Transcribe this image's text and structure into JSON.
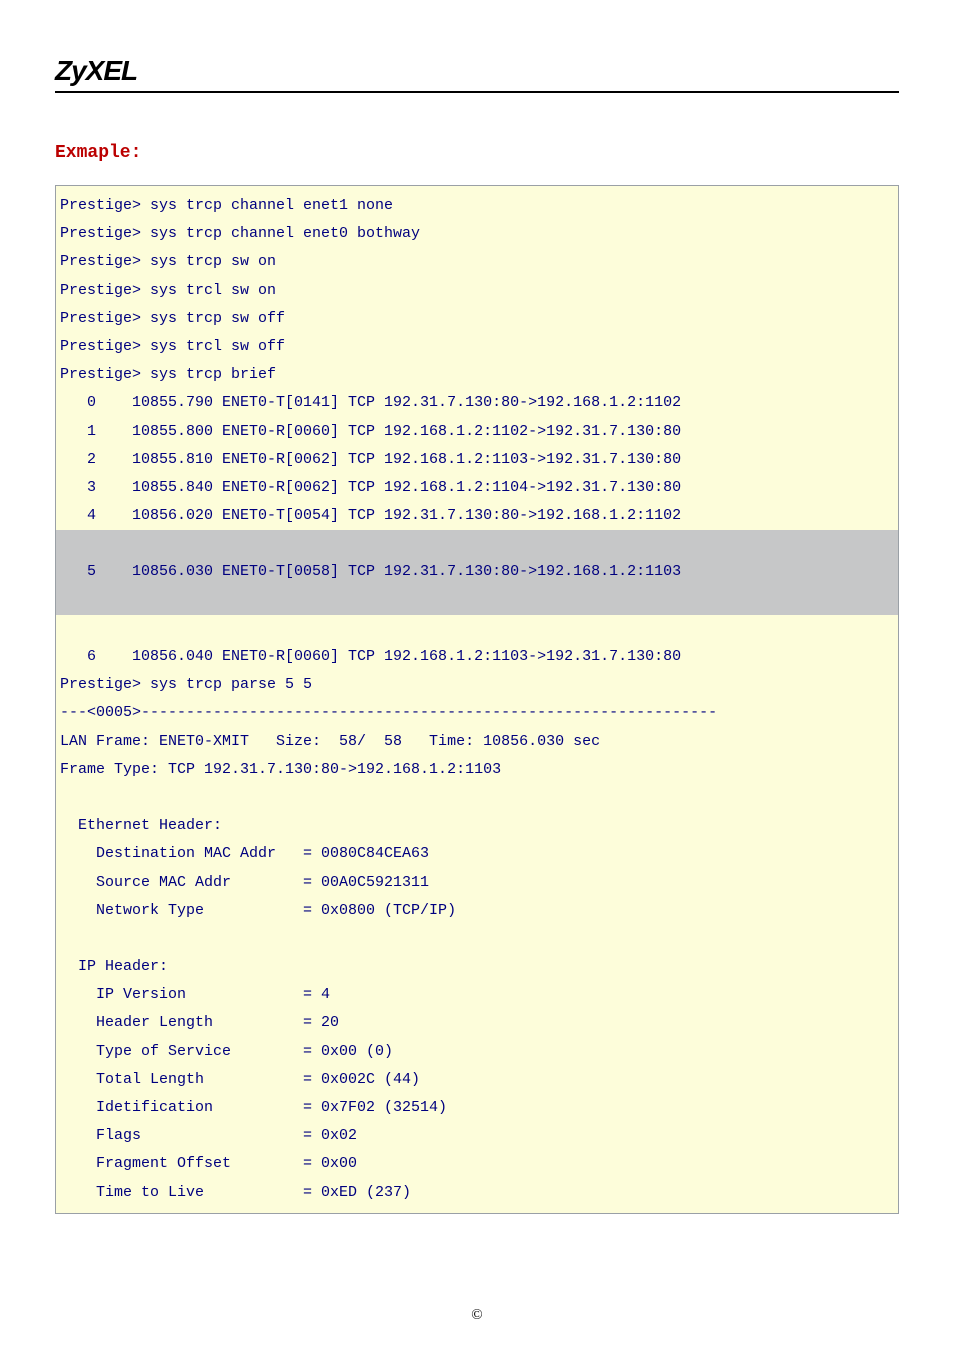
{
  "brand": "ZyXEL",
  "heading": "Exmaple:",
  "code": {
    "lines": [
      "Prestige> sys trcp channel enet1 none",
      "Prestige> sys trcp channel enet0 bothway",
      "Prestige> sys trcp sw on",
      "Prestige> sys trcl sw on",
      "Prestige> sys trcp sw off",
      "Prestige> sys trcl sw off",
      "Prestige> sys trcp brief",
      "   0    10855.790 ENET0-T[0141] TCP 192.31.7.130:80->192.168.1.2:1102",
      "   1    10855.800 ENET0-R[0060] TCP 192.168.1.2:1102->192.31.7.130:80",
      "   2    10855.810 ENET0-R[0062] TCP 192.168.1.2:1103->192.31.7.130:80",
      "   3    10855.840 ENET0-R[0062] TCP 192.168.1.2:1104->192.31.7.130:80",
      "   4    10856.020 ENET0-T[0054] TCP 192.31.7.130:80->192.168.1.2:1102",
      "",
      "   5    10856.030 ENET0-T[0058] TCP 192.31.7.130:80->192.168.1.2:1103",
      "",
      "",
      "   6    10856.040 ENET0-R[0060] TCP 192.168.1.2:1103->192.31.7.130:80",
      "Prestige> sys trcp parse 5 5",
      "---<0005>----------------------------------------------------------------",
      "LAN Frame: ENET0-XMIT   Size:  58/  58   Time: 10856.030 sec",
      "Frame Type: TCP 192.31.7.130:80->192.168.1.2:1103",
      "",
      "  Ethernet Header:",
      "    Destination MAC Addr   = 0080C84CEA63",
      "    Source MAC Addr        = 00A0C5921311",
      "    Network Type           = 0x0800 (TCP/IP)",
      "",
      "  IP Header:",
      "    IP Version             = 4",
      "    Header Length          = 20",
      "    Type of Service        = 0x00 (0)",
      "    Total Length           = 0x002C (44)",
      "    Idetification          = 0x7F02 (32514)",
      "    Flags                  = 0x02",
      "    Fragment Offset        = 0x00",
      "    Time to Live           = 0xED (237)"
    ],
    "highlight": [
      12,
      13,
      14
    ]
  },
  "footer": "©"
}
